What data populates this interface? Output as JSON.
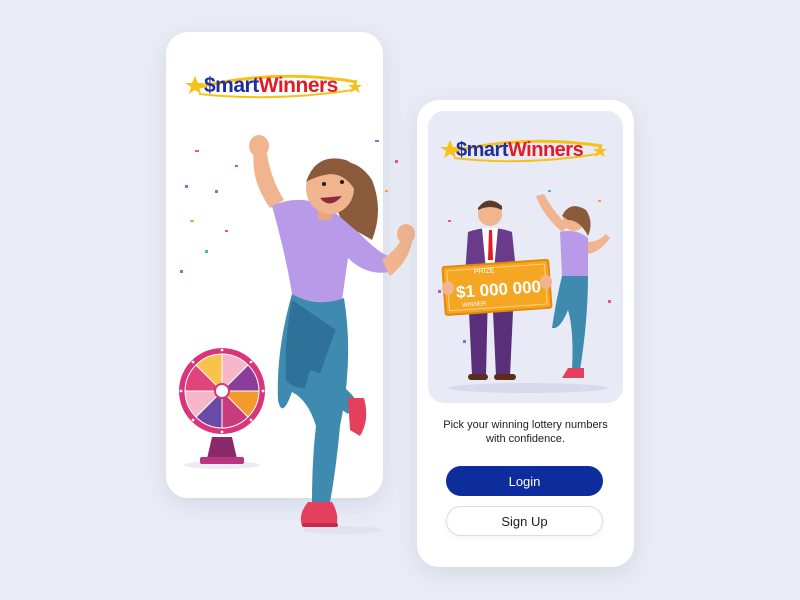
{
  "brand": {
    "logo_prefix": "$mart",
    "logo_suffix": "Winners",
    "primary_color": "#0d2d9c",
    "accent_red": "#e21b24",
    "logo_blue": "#1f2e9c"
  },
  "screen1": {
    "illustration": "celebrating-woman-and-prize-wheel"
  },
  "screen2": {
    "check": {
      "prize_label": "PRIZE",
      "amount": "$1 000 000",
      "winner_label": "WINNER"
    },
    "tagline_line1": "Pick your winning lottery numbers",
    "tagline_line2": "with confidence.",
    "login_label": "Login",
    "signup_label": "Sign Up"
  }
}
